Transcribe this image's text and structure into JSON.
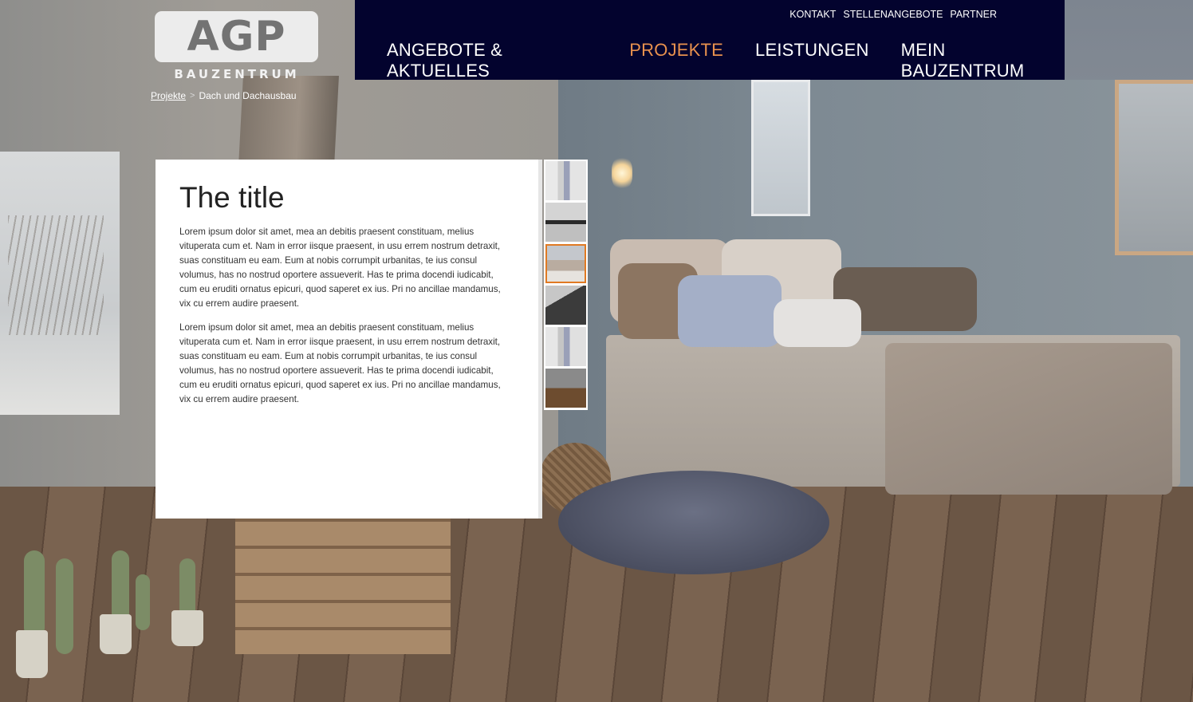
{
  "logo": {
    "mark": "AGP",
    "sub": "BAUZENTRUM"
  },
  "utility_nav": [
    "KONTAKT",
    "STELLENANGEBOTE",
    "PARTNER"
  ],
  "main_nav": [
    {
      "label": "ANGEBOTE & AKTUELLES",
      "active": false
    },
    {
      "label": "PROJEKTE",
      "active": true
    },
    {
      "label": "LEISTUNGEN",
      "active": false
    },
    {
      "label": "MEIN BAUZENTRUM",
      "active": false
    }
  ],
  "breadcrumb": {
    "parent": "Projekte",
    "separator": ">",
    "current": "Dach und Dachausbau"
  },
  "content": {
    "title": "The title",
    "paragraphs": [
      "Lorem ipsum dolor sit amet, mea an debitis praesent constituam, melius vituperata cum et. Nam in error iisque praesent, in usu errem nostrum detraxit, suas constituam eu eam. Eum at nobis corrumpit urbanitas, te ius consul volumus, has no nostrud oportere assueverit. Has te prima docendi iudicabit, cum eu eruditi ornatus epicuri, quod saperet ex ius. Pri no ancillae mandamus, vix cu errem audire praesent.",
      "Lorem ipsum dolor sit amet, mea an debitis praesent constituam, melius vituperata cum et. Nam in error iisque praesent, in usu errem nostrum detraxit, suas constituam eu eam. Eum at nobis corrumpit urbanitas, te ius consul volumus, has no nostrud oportere assueverit. Has te prima docendi iudicabit, cum eu eruditi ornatus epicuri, quod saperet ex ius. Pri no ancillae mandamus, vix cu errem audire praesent."
    ]
  },
  "gallery": {
    "thumbnail_count": 6,
    "selected_index": 2
  },
  "colors": {
    "nav_bg": "#03032e",
    "active_nav": "#e8914e",
    "thumb_active_border": "#e07a23"
  }
}
